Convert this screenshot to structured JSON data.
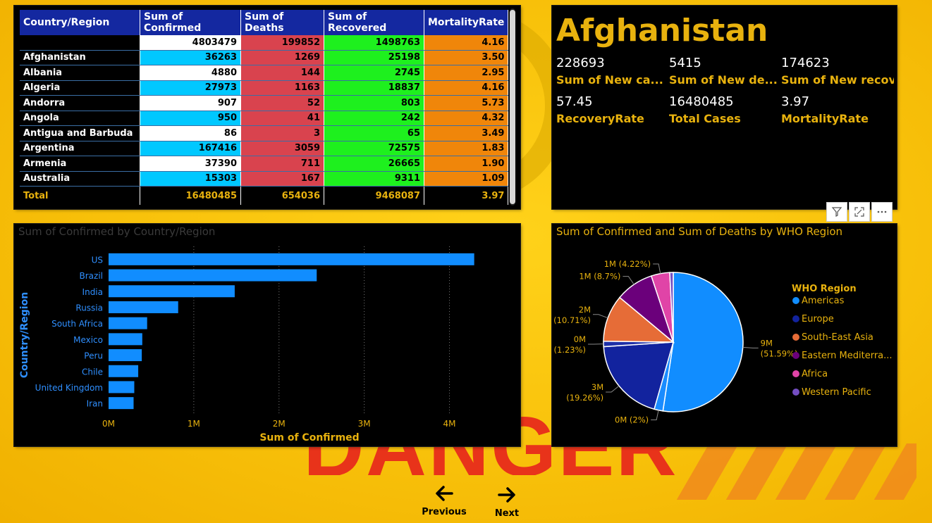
{
  "background": {
    "watermark": "DANGER",
    "accent_text_color": "#e8331a"
  },
  "table": {
    "headers": [
      "Country/Region",
      "Sum of Confirmed",
      "Sum of Deaths",
      "Sum of Recovered",
      "MortalityRate"
    ],
    "rows": [
      [
        "",
        "4803479",
        "199852",
        "1498763",
        "4.16"
      ],
      [
        "Afghanistan",
        "36263",
        "1269",
        "25198",
        "3.50"
      ],
      [
        "Albania",
        "4880",
        "144",
        "2745",
        "2.95"
      ],
      [
        "Algeria",
        "27973",
        "1163",
        "18837",
        "4.16"
      ],
      [
        "Andorra",
        "907",
        "52",
        "803",
        "5.73"
      ],
      [
        "Angola",
        "950",
        "41",
        "242",
        "4.32"
      ],
      [
        "Antigua and Barbuda",
        "86",
        "3",
        "65",
        "3.49"
      ],
      [
        "Argentina",
        "167416",
        "3059",
        "72575",
        "1.83"
      ],
      [
        "Armenia",
        "37390",
        "711",
        "26665",
        "1.90"
      ],
      [
        "Australia",
        "15303",
        "167",
        "9311",
        "1.09"
      ]
    ],
    "total": [
      "Total",
      "16480485",
      "654036",
      "9468087",
      "3.97"
    ]
  },
  "card": {
    "title": "Afghanistan",
    "kpis": [
      {
        "value": "228693",
        "label": "Sum of New ca..."
      },
      {
        "value": "5415",
        "label": "Sum of New de..."
      },
      {
        "value": "174623",
        "label": "Sum of New recov..."
      },
      {
        "value": "57.45",
        "label": "RecoveryRate"
      },
      {
        "value": "16480485",
        "label": "Total Cases"
      },
      {
        "value": "3.97",
        "label": "MortalityRate"
      }
    ],
    "icons": [
      "filter-icon",
      "focus-mode-icon",
      "more-options-icon"
    ]
  },
  "chart_data": [
    {
      "type": "bar",
      "orientation": "horizontal",
      "title": "Sum of Confirmed by Country/Region",
      "xlabel": "Sum of Confirmed",
      "ylabel": "Country/Region",
      "categories": [
        "US",
        "Brazil",
        "India",
        "Russia",
        "South Africa",
        "Mexico",
        "Peru",
        "Chile",
        "United Kingdom",
        "Iran"
      ],
      "values": [
        4290259,
        2442375,
        1480073,
        816680,
        452529,
        395489,
        389717,
        347923,
        301708,
        293606
      ],
      "xlim": [
        0,
        4500000
      ],
      "xticks": [
        "0M",
        "1M",
        "2M",
        "3M",
        "4M"
      ],
      "xtick_values": [
        0,
        1000000,
        2000000,
        3000000,
        4000000
      ],
      "grid": true,
      "bar_color": "#118dff",
      "title_color": "#3a3a3a",
      "label_color": "#2f8fff",
      "axis_title_color": "#e8b20e"
    },
    {
      "type": "pie",
      "title": "Sum of Confirmed and Sum of Deaths by WHO Region",
      "legend_title": "WHO Region",
      "legend_position": "right",
      "slices": [
        {
          "name": "Americas",
          "value": 51.59,
          "label": "9M",
          "pct": "(51.59%)",
          "color": "#118dff"
        },
        {
          "name": "",
          "value": 2.0,
          "label": "0M (2%)",
          "pct": "",
          "color": "#1a8cff"
        },
        {
          "name": "Europe",
          "value": 19.26,
          "label": "3M",
          "pct": "(19.26%)",
          "color": "#12239e"
        },
        {
          "name": "",
          "value": 1.23,
          "label": "0M",
          "pct": "(1.23%)",
          "color": "#1e2fa8"
        },
        {
          "name": "South-East Asia",
          "value": 10.71,
          "label": "2M",
          "pct": "(10.71%)",
          "color": "#e66c37"
        },
        {
          "name": "Eastern Mediterra...",
          "value": 8.7,
          "label": "1M (8.7%)",
          "pct": "",
          "color": "#6b007b"
        },
        {
          "name": "Africa",
          "value": 4.22,
          "label": "1M (4.22%)",
          "pct": "",
          "color": "#e044a7"
        },
        {
          "name": "",
          "value": 0.8,
          "label": "",
          "pct": "",
          "color": "#744ec2"
        }
      ],
      "legend": [
        {
          "name": "Americas",
          "color": "#118dff"
        },
        {
          "name": "Europe",
          "color": "#12239e"
        },
        {
          "name": "South-East Asia",
          "color": "#e66c37"
        },
        {
          "name": "Eastern Mediterra...",
          "color": "#6b007b"
        },
        {
          "name": "Africa",
          "color": "#e044a7"
        },
        {
          "name": "Western Pacific",
          "color": "#744ec2"
        }
      ],
      "title_color": "#e8b20e",
      "label_color": "#e8b20e"
    }
  ],
  "nav": {
    "previous_label": "Previous",
    "next_label": "Next"
  }
}
